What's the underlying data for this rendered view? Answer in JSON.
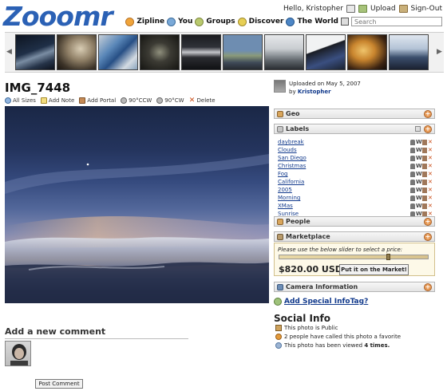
{
  "header": {
    "logo": "Zooomr",
    "greeting": "Hello, Kristopher",
    "upload": "Upload",
    "signout": "Sign-Out",
    "nav": [
      "Zipline",
      "You",
      "Groups",
      "Discover",
      "The World"
    ],
    "search_placeholder": "Search"
  },
  "photo": {
    "title": "IMG_7448",
    "tools": [
      "All Sizes",
      "Add Note",
      "Add Portal",
      "90°CCW",
      "90°CW",
      "Delete"
    ]
  },
  "uploader": {
    "uploaded_on": "Uploaded on May 5, 2007",
    "by_label": "by",
    "by_name": "Kristopher"
  },
  "panels": {
    "geo": "Geo",
    "labels": "Labels",
    "people": "People",
    "marketplace": "Marketplace",
    "camera": "Camera Information"
  },
  "labels": [
    "daybreak",
    "Clouds",
    "San Diego",
    "Christmas",
    "Fog",
    "California",
    "2005",
    "Morning",
    "XMas",
    "Sunrise"
  ],
  "label_action_icons": [
    "user-icon",
    "wiki-icon",
    "edit-icon",
    "remove-icon"
  ],
  "marketplace": {
    "tip": "Please use the below slider to select a price:",
    "price": "$820.00 USD",
    "button": "Put it on the Market!",
    "slider_fraction": 0.74
  },
  "add_tag": "Add Special InfoTag?",
  "social": {
    "heading": "Social Info",
    "public": "This photo is Public",
    "favorites": "2 people  have called this photo a favorite",
    "views_prefix": "This photo has been viewed ",
    "views": "4 times."
  },
  "comments": {
    "heading": "Add a new comment",
    "post_button": "Post Comment"
  }
}
